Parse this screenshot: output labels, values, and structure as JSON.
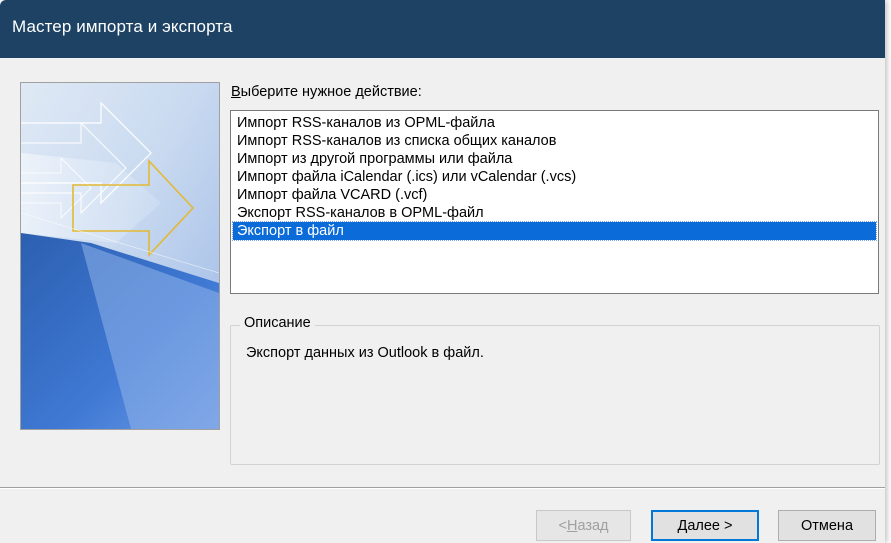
{
  "window": {
    "title": "Мастер импорта и экспорта"
  },
  "prompt": {
    "label_accel": "В",
    "label_rest": "ыберите нужное действие:"
  },
  "actions": {
    "selected_index": 6,
    "items": [
      {
        "label": "Импорт RSS-каналов из OPML-файла"
      },
      {
        "label": "Импорт RSS-каналов из списка общих каналов"
      },
      {
        "label": "Импорт из другой программы или файла"
      },
      {
        "label": "Импорт файла iCalendar (.ics) или vCalendar (.vcs)"
      },
      {
        "label": "Импорт файла VCARD (.vcf)"
      },
      {
        "label": "Экспорт RSS-каналов в OPML-файл"
      },
      {
        "label": "Экспорт в файл"
      }
    ]
  },
  "description": {
    "legend": "Описание",
    "text": "Экспорт данных из Outlook в файл."
  },
  "buttons": {
    "back_prefix": "< ",
    "back_accel": "Н",
    "back_rest": "азад",
    "next_accel": "Д",
    "next_rest": "алее >",
    "cancel": "Отмена"
  },
  "colors": {
    "titlebar": "#1d4264",
    "selection": "#0b6cd9",
    "dialog_bg": "#f0f0f0",
    "default_button_border": "#0078d7"
  },
  "icons": {
    "wizard_banner": "import-export-arrows-banner"
  }
}
